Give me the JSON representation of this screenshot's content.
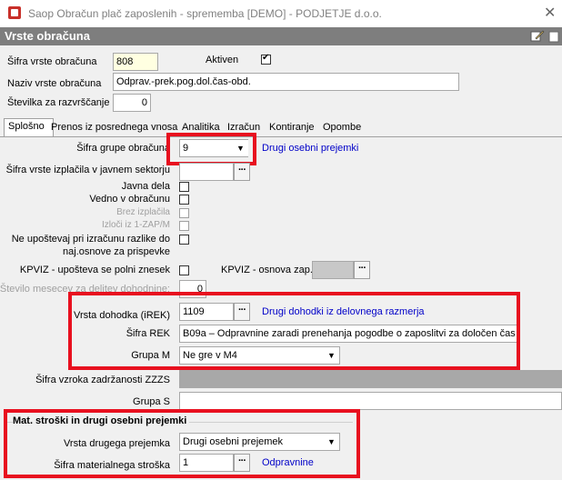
{
  "window": {
    "title": "Saop Obračun plač zaposlenih - sprememba [DEMO] - PODJETJE d.o.o."
  },
  "header": {
    "title": "Vrste obračuna"
  },
  "top": {
    "sifra_label": "Šifra vrste obračuna",
    "sifra_value": "808",
    "aktiven_label": "Aktiven",
    "aktiven_checked": true,
    "naziv_label": "Naziv vrste obračuna",
    "naziv_value": "Odprav.-prek.pog.dol.čas-obd.",
    "stevilka_label": "Številka  za razvrščanje",
    "stevilka_value": "0"
  },
  "tabs": [
    "Splošno",
    "Prenos iz posrednega vnosa",
    "Analitika",
    "Izračun",
    "Kontiranje",
    "Opombe"
  ],
  "general": {
    "grupa_label": "Šifra grupe obračuna",
    "grupa_value": "9",
    "grupa_desc": "Drugi osebni prejemki",
    "izplacila_label": "Šifra vrste izplačila v javnem sektorju",
    "javna_dela_label": "Javna dela",
    "vedno_label": "Vedno v obračunu",
    "brez_label": "Brez izplačila",
    "izloci_label": "Izloči iz 1-ZAP/M",
    "neupostevaj_label_1": "Ne upoštevaj pri izračunu razlike do",
    "neupostevaj_label_2": "naj.osnove za prispevke",
    "kpviz_label": "KPVIZ - upošteva se polni znesek",
    "kpviz_osnova_label": "KPVIZ - osnova zap.",
    "mesecev_label": "Število mesecev za delitev dohodnine:",
    "mesecev_value": "0"
  },
  "dohodek": {
    "vrsta_label": "Vrsta dohodka (iREK)",
    "vrsta_value": "1109",
    "vrsta_desc": "Drugi dohodki iz delovnega razmerja",
    "rek_label": "Šifra REK",
    "rek_value": "B09a – Odpravnine zaradi prenehanja pogodbe o zaposlitvi za določen čas",
    "grupam_label": "Grupa M",
    "grupam_value": "Ne gre v M4"
  },
  "zzzs": {
    "label": "Šifra vzroka zadržanosti ZZZS"
  },
  "grupas": {
    "label": "Grupa S"
  },
  "mat": {
    "title": "Mat. stroški in drugi osebni prejemki",
    "vrsta_label": "Vrsta drugega prejemka",
    "vrsta_value": "Drugi osebni prejemek",
    "sifra_label": "Šifra materialnega stroška",
    "sifra_value": "1",
    "sifra_desc": "Odpravnine"
  },
  "icons": {
    "dropdown": "chevron-down-icon",
    "lookup": "ellipsis-icon",
    "edit": "pencil-icon",
    "help": "help-icon"
  },
  "colors": {
    "header_bg": "#7e7e7e",
    "highlight": "#e8101f",
    "link": "#0000c8",
    "input_focus": "#ffffe1"
  }
}
